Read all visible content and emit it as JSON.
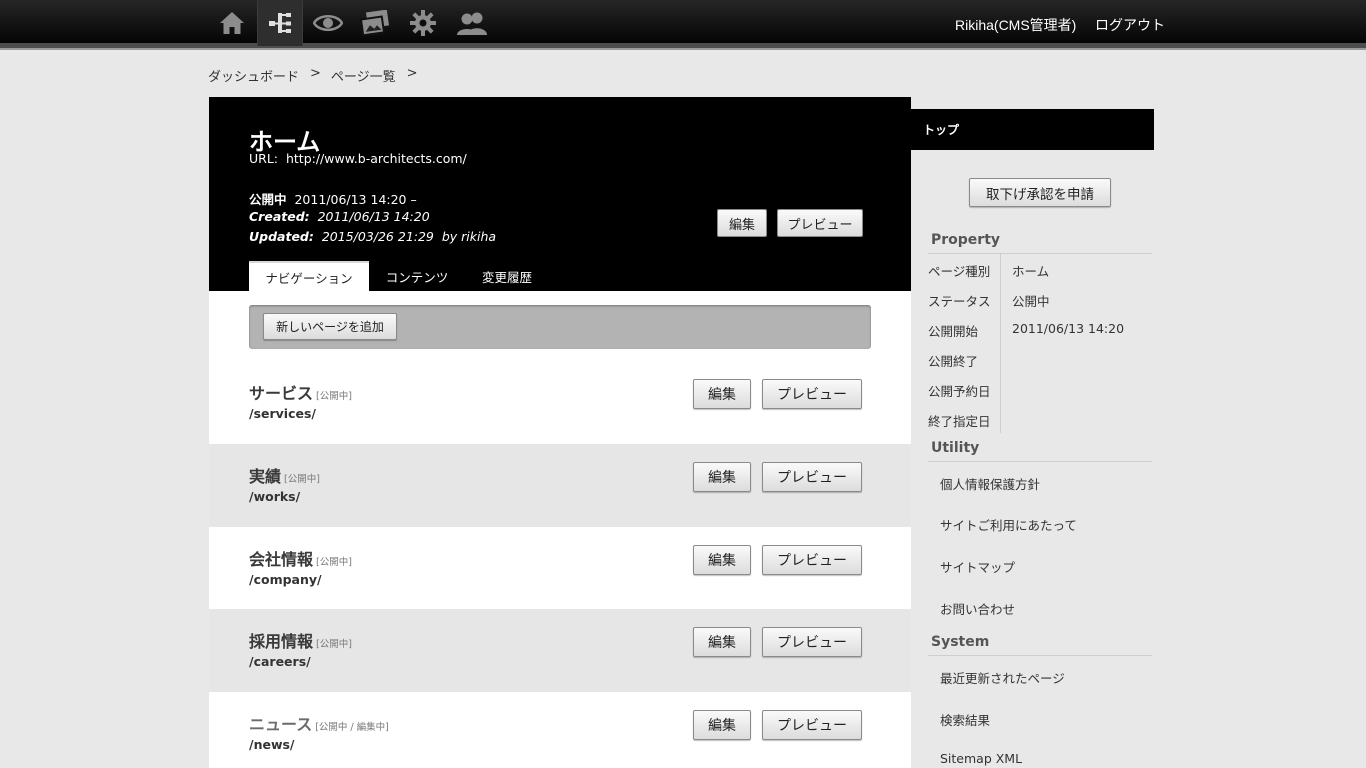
{
  "topbar": {
    "icons": [
      "home-icon",
      "sitemap-icon",
      "eye-icon",
      "images-icon",
      "gear-icon",
      "users-icon"
    ],
    "user": "Rikiha(CMS管理者)",
    "logout": "ログアウト"
  },
  "breadcrumb": {
    "items": [
      "ダッシュボード",
      "ページ一覧"
    ],
    "separator": ">"
  },
  "page": {
    "title": "ホーム",
    "url_label": "URL:",
    "url": "http://www.b-architects.com/",
    "status_label": "公開中",
    "status_value": "2011/06/13 14:20 –",
    "created_label": "Created:",
    "created_value": "2011/06/13 14:20",
    "updated_label": "Updated:",
    "updated_value": "2015/03/26 21:29",
    "updated_by": "by rikiha",
    "edit_label": "編集",
    "preview_label": "プレビュー"
  },
  "tabs": [
    "ナビゲーション",
    "コンテンツ",
    "変更履歴"
  ],
  "toolbar": {
    "add_page_label": "新しいページを追加"
  },
  "rows": [
    {
      "title": "サービス",
      "status": "[公開中]",
      "path": "/services/"
    },
    {
      "title": "実績",
      "status": "[公開中]",
      "path": "/works/"
    },
    {
      "title": "会社情報",
      "status": "[公開中]",
      "path": "/company/"
    },
    {
      "title": "採用情報",
      "status": "[公開中]",
      "path": "/careers/"
    },
    {
      "title": "ニュース",
      "status": "[公開中 / 編集中]",
      "path": "/news/"
    }
  ],
  "row_buttons": {
    "edit": "編集",
    "preview": "プレビュー"
  },
  "sidebar": {
    "head": "トップ",
    "request_button": "取下げ承認を申請",
    "property_title": "Property",
    "properties": [
      {
        "label": "ページ種別",
        "value": "ホーム"
      },
      {
        "label": "ステータス",
        "value": "公開中"
      },
      {
        "label": "公開開始",
        "value": "2011/06/13 14:20"
      },
      {
        "label": "公開終了",
        "value": ""
      },
      {
        "label": "公開予約日",
        "value": ""
      },
      {
        "label": "終了指定日",
        "value": ""
      }
    ],
    "utility_title": "Utility",
    "utility_links": [
      "個人情報保護方針",
      "サイトご利用にあたって",
      "サイトマップ",
      "お問い合わせ"
    ],
    "system_title": "System",
    "system_links": [
      "最近更新されたページ",
      "検索結果",
      "Sitemap XML"
    ]
  }
}
